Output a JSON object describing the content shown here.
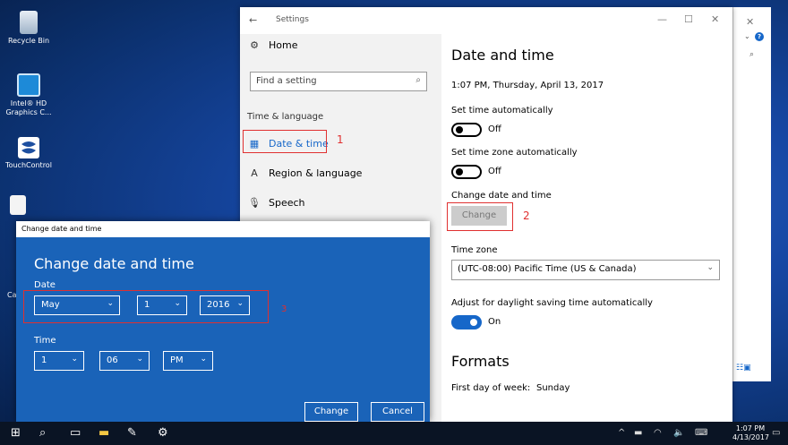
{
  "desktop": {
    "icons": [
      {
        "label": "Recycle Bin"
      },
      {
        "label": "Intel® HD Graphics C..."
      },
      {
        "label": "TouchControl"
      },
      {
        "label": "Ca"
      }
    ]
  },
  "settings": {
    "window_title": "Settings",
    "back": "←",
    "controls": {
      "minimize": "—",
      "maximize": "☐",
      "close": "✕"
    },
    "nav": {
      "home": "Home",
      "search_placeholder": "Find a setting",
      "section": "Time & language",
      "items": [
        {
          "label": "Date & time"
        },
        {
          "label": "Region & language"
        },
        {
          "label": "Speech"
        }
      ]
    },
    "content": {
      "title": "Date and time",
      "current_time": "1:07 PM, Thursday, April 13, 2017",
      "set_time_auto_label": "Set time automatically",
      "set_time_auto_state": "Off",
      "set_tz_auto_label": "Set time zone automatically",
      "set_tz_auto_state": "Off",
      "change_label": "Change date and time",
      "change_button": "Change",
      "time_zone_label": "Time zone",
      "time_zone_value": "(UTC-08:00) Pacific Time (US & Canada)",
      "dst_label": "Adjust for daylight saving time automatically",
      "dst_state": "On",
      "formats_title": "Formats",
      "first_day_label": "First day of week:",
      "first_day_value": "Sunday"
    }
  },
  "annotations": {
    "n1": "1",
    "n2": "2",
    "n3": "3"
  },
  "dialog": {
    "window_title": "Change date and time",
    "title": "Change date and time",
    "date_label": "Date",
    "month": "May",
    "day": "1",
    "year": "2016",
    "time_label": "Time",
    "hour": "1",
    "minute": "06",
    "ampm": "PM",
    "change_button": "Change",
    "cancel_button": "Cancel"
  },
  "taskbar": {
    "time": "1:07 PM",
    "date": "4/13/2017"
  }
}
